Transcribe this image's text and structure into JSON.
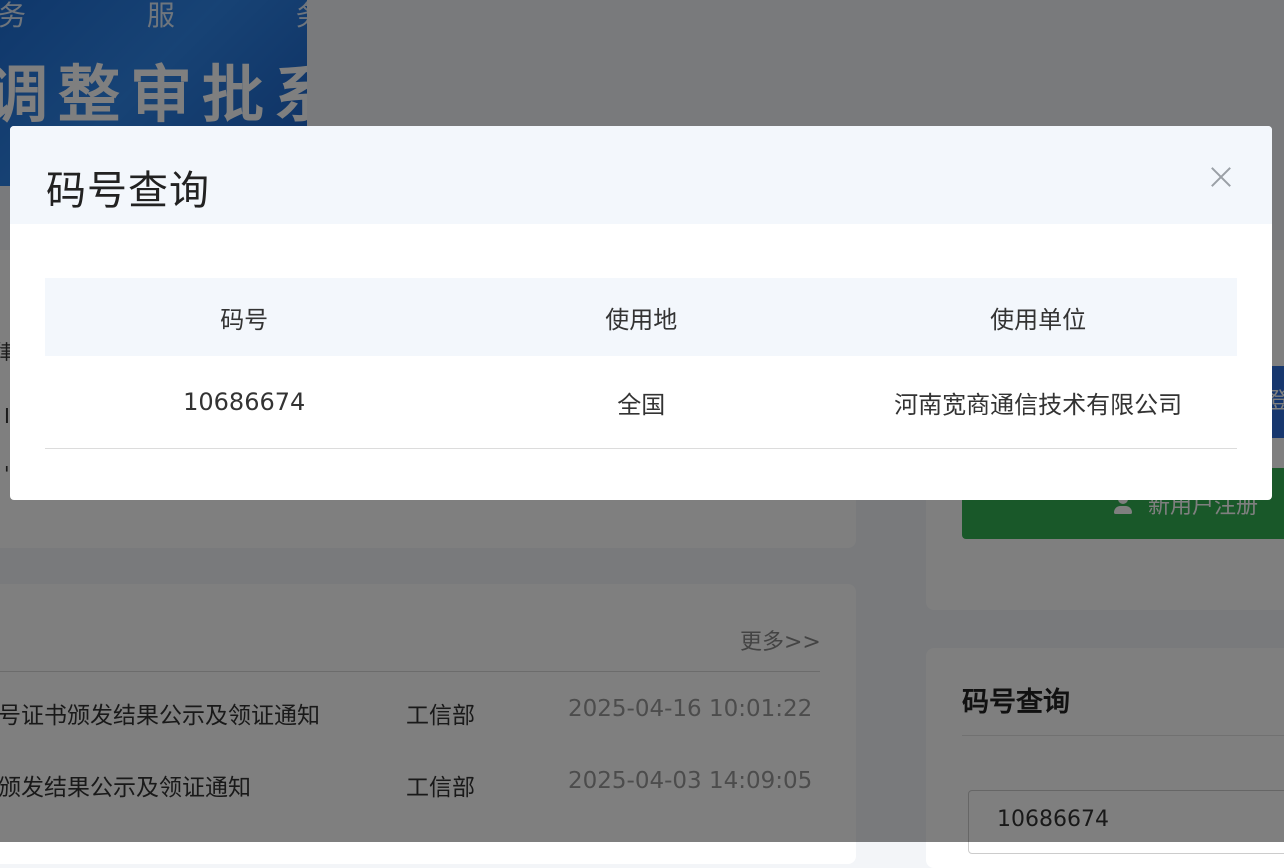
{
  "banner": {
    "subtitle": "务 服 务 平",
    "title": "调整审批系"
  },
  "background": {
    "left_fragments": [
      "律",
      "I",
      "'"
    ],
    "login_button_fragment": "登",
    "register_button_label": "新用户注册",
    "news": {
      "more_link": "更多>>",
      "rows": [
        {
          "title": "号证书颁发结果公示及领证通知",
          "org": "工信部",
          "time": "2025-04-16 10:01:22"
        },
        {
          "title": "颁发结果公示及领证通知",
          "org": "工信部",
          "time": "2025-04-03 14:09:05"
        }
      ]
    },
    "query_panel": {
      "title": "码号查询",
      "input_value": "10686674"
    }
  },
  "modal": {
    "title": "码号查询",
    "close_icon": "close-icon",
    "table": {
      "headers": [
        "码号",
        "使用地",
        "使用单位"
      ],
      "rows": [
        [
          "10686674",
          "全国",
          "河南宽商通信技术有限公司"
        ]
      ]
    }
  },
  "colors": {
    "overlay": "rgba(0,0,0,0.5)",
    "header_bg": "#f3f7fc",
    "register_green": "#33b152",
    "login_blue": "#2f6fdc"
  }
}
